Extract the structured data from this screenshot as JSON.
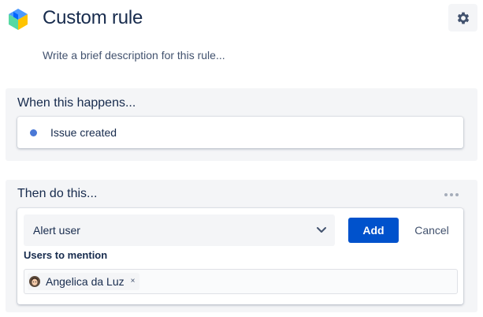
{
  "header": {
    "title": "Custom rule",
    "description_placeholder": "Write a brief description for this rule...",
    "logo_icon": "automation-cube-icon",
    "settings_icon": "gear-icon"
  },
  "when_panel": {
    "heading": "When this happens...",
    "trigger": {
      "label": "Issue created",
      "dot_color": "#4a78d6"
    }
  },
  "then_panel": {
    "heading": "Then do this...",
    "more_icon": "more-horizontal-icon",
    "action": {
      "selected": "Alert user",
      "add_label": "Add",
      "cancel_label": "Cancel",
      "field_label": "Users to mention",
      "users": [
        {
          "name": "Angelica da Luz",
          "remove": "×"
        }
      ]
    }
  },
  "colors": {
    "primary": "#0052cc",
    "text": "#172b4d",
    "panel_bg": "#f4f5f7"
  }
}
